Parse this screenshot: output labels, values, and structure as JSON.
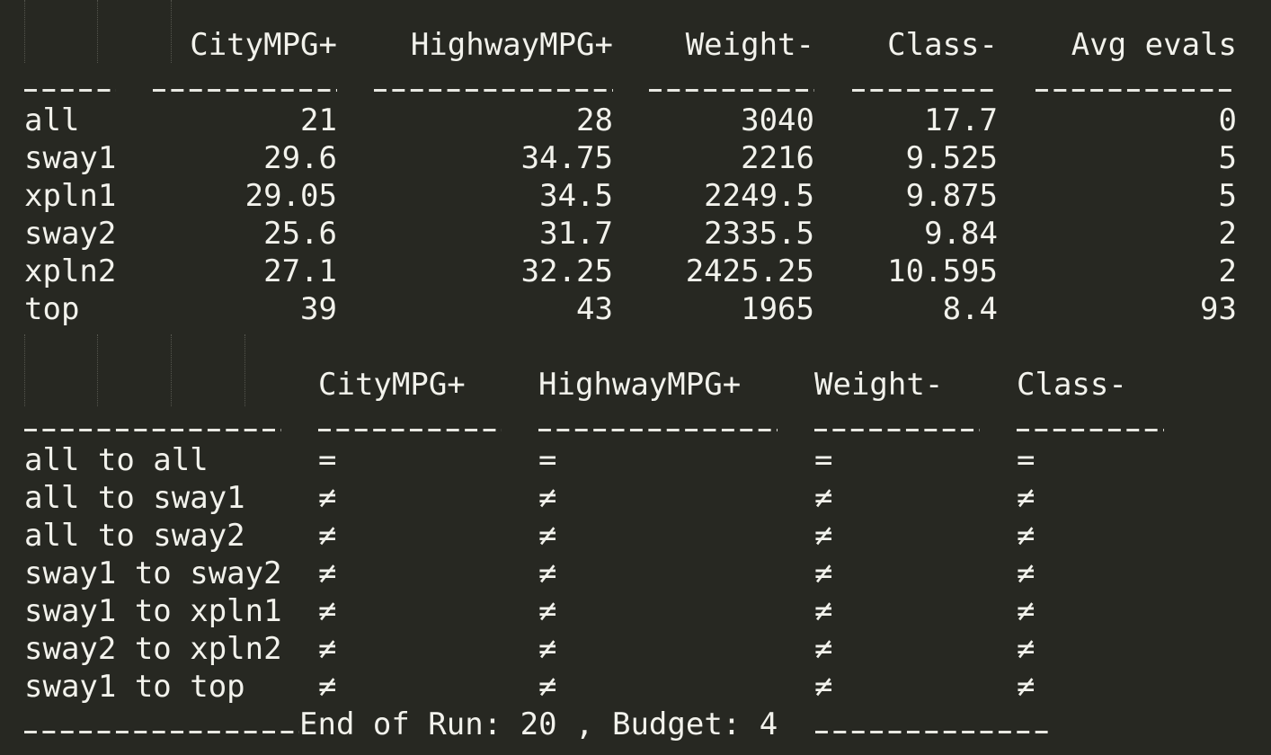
{
  "summary_table": {
    "headers": [
      "",
      "CityMPG+",
      "HighwayMPG+",
      "Weight-",
      "Class-",
      "Avg evals"
    ],
    "rows": [
      {
        "label": "all",
        "values": [
          "21",
          "28",
          "3040",
          "17.7",
          "0"
        ]
      },
      {
        "label": "sway1",
        "values": [
          "29.6",
          "34.75",
          "2216",
          "9.525",
          "5"
        ]
      },
      {
        "label": "xpln1",
        "values": [
          "29.05",
          "34.5",
          "2249.5",
          "9.875",
          "5"
        ]
      },
      {
        "label": "sway2",
        "values": [
          "25.6",
          "31.7",
          "2335.5",
          "9.84",
          "2"
        ]
      },
      {
        "label": "xpln2",
        "values": [
          "27.1",
          "32.25",
          "2425.25",
          "10.595",
          "2"
        ]
      },
      {
        "label": "top",
        "values": [
          "39",
          "43",
          "1965",
          "8.4",
          "93"
        ]
      }
    ]
  },
  "comparison_table": {
    "headers": [
      "",
      "CityMPG+",
      "HighwayMPG+",
      "Weight-",
      "Class-"
    ],
    "rows": [
      {
        "label": "all to all",
        "values": [
          "=",
          "=",
          "=",
          "="
        ]
      },
      {
        "label": "all to sway1",
        "values": [
          "≠",
          "≠",
          "≠",
          "≠"
        ]
      },
      {
        "label": "all to sway2",
        "values": [
          "≠",
          "≠",
          "≠",
          "≠"
        ]
      },
      {
        "label": "sway1 to sway2",
        "values": [
          "≠",
          "≠",
          "≠",
          "≠"
        ]
      },
      {
        "label": "sway1 to xpln1",
        "values": [
          "≠",
          "≠",
          "≠",
          "≠"
        ]
      },
      {
        "label": "sway2 to xpln2",
        "values": [
          "≠",
          "≠",
          "≠",
          "≠"
        ]
      },
      {
        "label": "sway1 to top",
        "values": [
          "≠",
          "≠",
          "≠",
          "≠"
        ]
      }
    ]
  },
  "footer": {
    "text": "End of Run: 20 , Budget: 4"
  }
}
